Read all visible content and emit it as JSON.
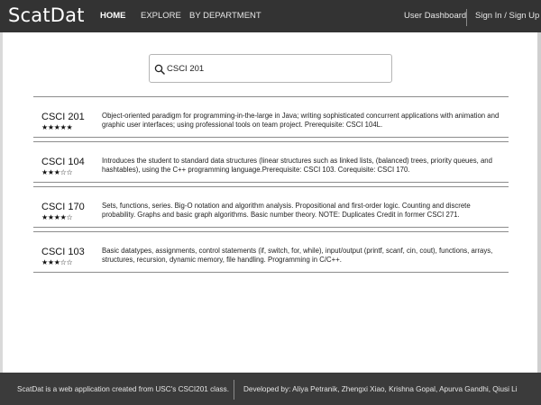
{
  "header": {
    "brand": "ScatDat",
    "nav": {
      "home": "HOME",
      "explore": "EXPLORE",
      "department": "BY DEPARTMENT",
      "dashboard": "User Dashboard",
      "signin": "Sign In / Sign Up"
    }
  },
  "search": {
    "value": "CSCI 201",
    "icon": "search-icon"
  },
  "courses": [
    {
      "code": "CSCI 201",
      "rating": 5,
      "stars": "★★★★★",
      "description": "Object-oriented paradigm for programming-in-the-large in Java; writing sophisticated concurrent applications with animation and graphic user interfaces; using professional tools on team project. Prerequisite: CSCI 104L."
    },
    {
      "code": "CSCI 104",
      "rating": 3,
      "stars": "★★★☆☆",
      "description": "Introduces the student to standard data structures (linear structures such as linked lists, (balanced) trees, priority queues, and hashtables), using the C++ programming language.Prerequisite: CSCI 103. Corequisite: CSCI 170."
    },
    {
      "code": "CSCI 170",
      "rating": 4,
      "stars": "★★★★☆",
      "description": "Sets, functions, series. Big-O notation and algorithm analysis. Propositional and first-order logic. Counting and discrete probability. Graphs and basic graph algorithms. Basic number theory. NOTE: Duplicates Credit in former CSCI 271."
    },
    {
      "code": "CSCI 103",
      "rating": 3,
      "stars": "★★★☆☆",
      "description": "Basic datatypes, assignments, control statements (if, switch, for, while), input/output (printf, scanf, cin, cout), functions, arrays, structures, recursion, dynamic memory, file handling. Programming in C/C++."
    }
  ],
  "footer": {
    "about": "ScatDat is a web application created from USC's CSCI201 class.",
    "credits": "Developed by: Aliya Petranik, Zhengxi Xiao, Krishna Gopal, Apurva Gandhi, Qiusi Li"
  },
  "colors": {
    "navbar": "#333333",
    "footer": "#3b3b3b",
    "separator": "#8c8c8c"
  }
}
